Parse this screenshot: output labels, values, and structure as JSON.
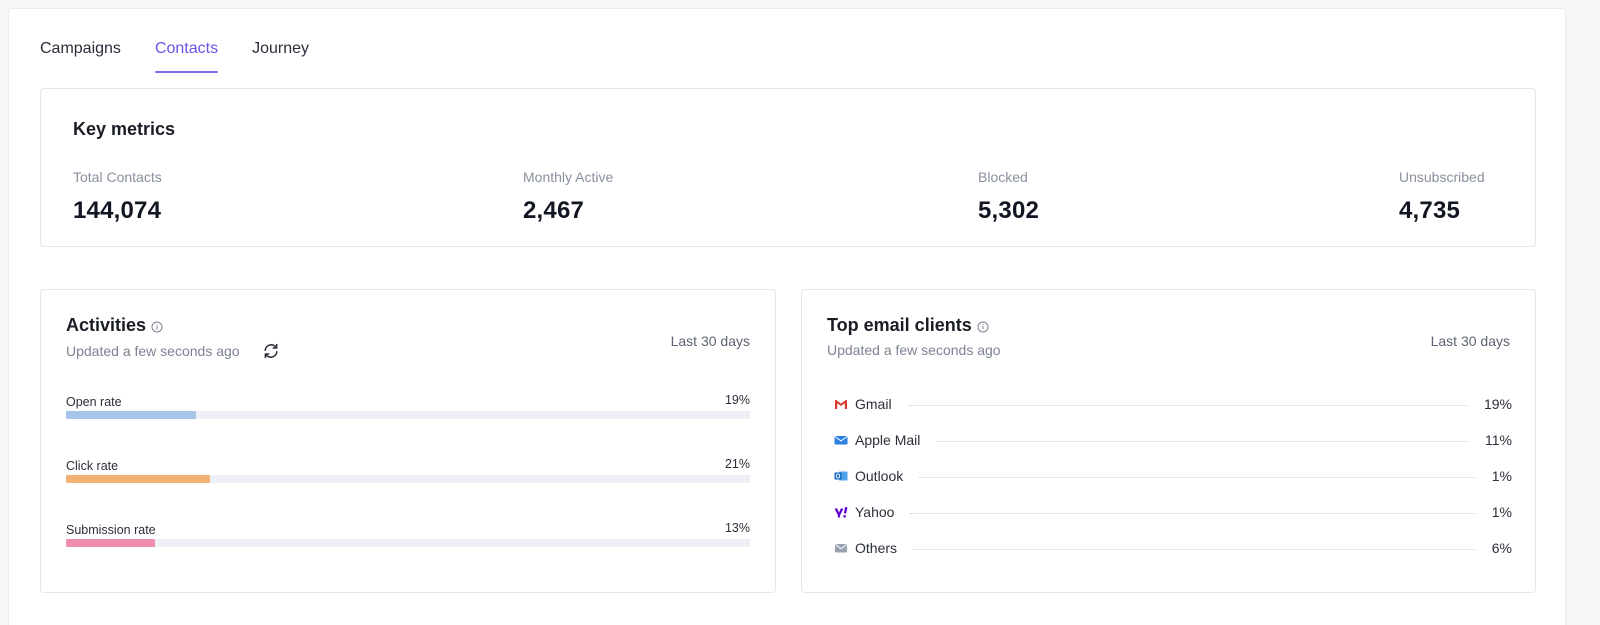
{
  "tabs": [
    {
      "label": "Campaigns",
      "active": false
    },
    {
      "label": "Contacts",
      "active": true
    },
    {
      "label": "Journey",
      "active": false
    }
  ],
  "key_metrics": {
    "title": "Key metrics",
    "items": [
      {
        "label": "Total Contacts",
        "value": "144,074"
      },
      {
        "label": "Monthly Active",
        "value": "2,467"
      },
      {
        "label": "Blocked",
        "value": "5,302"
      },
      {
        "label": "Unsubscribed",
        "value": "4,735"
      }
    ]
  },
  "activities": {
    "title": "Activities",
    "subtitle": "Updated a few seconds ago",
    "range": "Last 30 days",
    "rates": [
      {
        "label": "Open rate",
        "value": "19%",
        "percent": 19,
        "color": "#a6c4e8"
      },
      {
        "label": "Click rate",
        "value": "21%",
        "percent": 21,
        "color": "#f1b274"
      },
      {
        "label": "Submission rate",
        "value": "13%",
        "percent": 13,
        "color": "#ee8fb0"
      }
    ]
  },
  "email_clients": {
    "title": "Top email clients",
    "subtitle": "Updated a few seconds ago",
    "range": "Last 30 days",
    "items": [
      {
        "name": "Gmail",
        "value": "19%",
        "icon": "gmail-icon"
      },
      {
        "name": "Apple Mail",
        "value": "11%",
        "icon": "apple-mail-icon"
      },
      {
        "name": "Outlook",
        "value": "1%",
        "icon": "outlook-icon"
      },
      {
        "name": "Yahoo",
        "value": "1%",
        "icon": "yahoo-icon"
      },
      {
        "name": "Others",
        "value": "6%",
        "icon": "others-mail-icon"
      }
    ]
  },
  "colors": {
    "accent": "#6656e6",
    "text_muted": "#8a90a0"
  }
}
